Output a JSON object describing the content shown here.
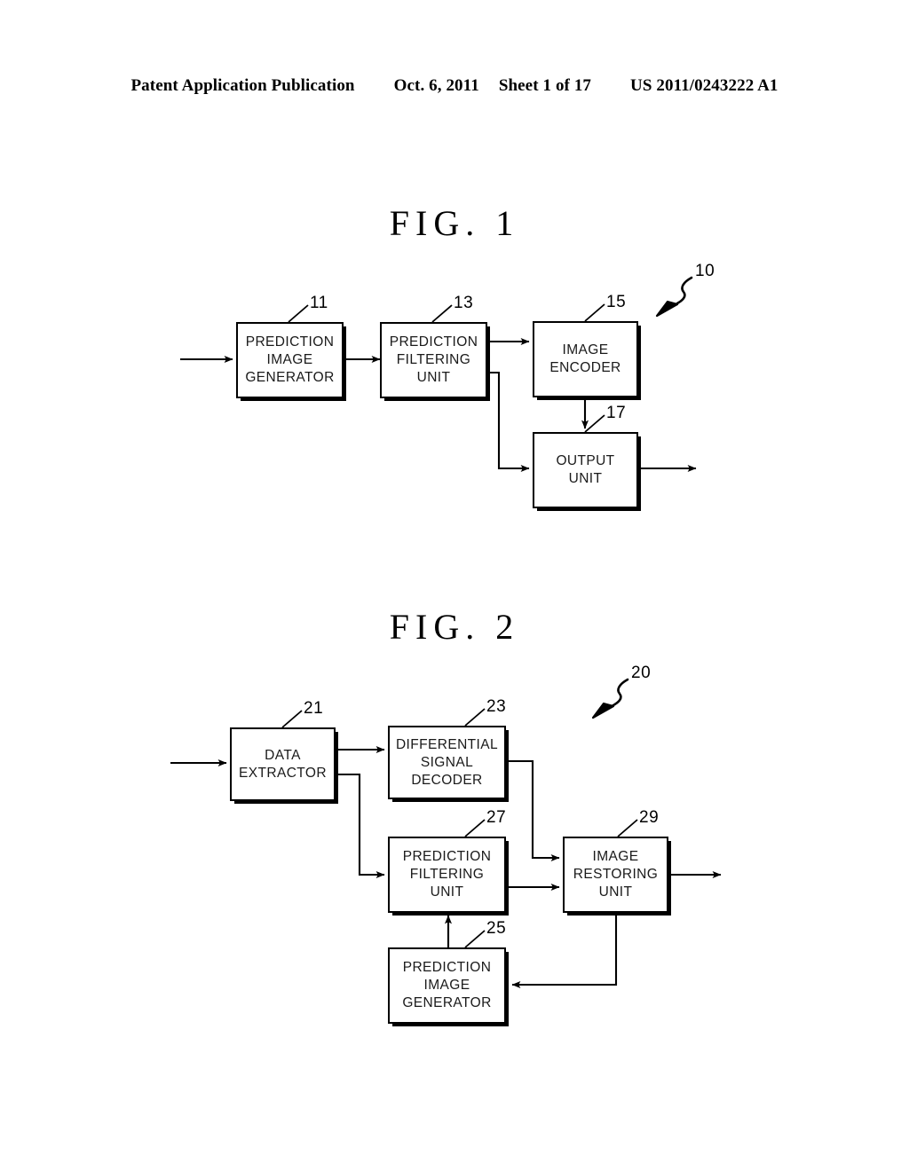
{
  "header": {
    "publication": "Patent Application Publication",
    "date": "Oct. 6, 2011",
    "sheet": "Sheet 1 of 17",
    "number": "US 2011/0243222 A1"
  },
  "figures": [
    {
      "id": "fig1",
      "title": "FIG.  1",
      "assembly_ref": "10",
      "blocks": [
        {
          "ref": "11",
          "lines": [
            "PREDICTION",
            "IMAGE",
            "GENERATOR"
          ]
        },
        {
          "ref": "13",
          "lines": [
            "PREDICTION",
            "FILTERING",
            "UNIT"
          ]
        },
        {
          "ref": "15",
          "lines": [
            "IMAGE",
            "ENCODER"
          ]
        },
        {
          "ref": "17",
          "lines": [
            "OUTPUT",
            "UNIT"
          ]
        }
      ]
    },
    {
      "id": "fig2",
      "title": "FIG.  2",
      "assembly_ref": "20",
      "blocks": [
        {
          "ref": "21",
          "lines": [
            "DATA",
            "EXTRACTOR"
          ]
        },
        {
          "ref": "23",
          "lines": [
            "DIFFERENTIAL",
            "SIGNAL",
            "DECODER"
          ]
        },
        {
          "ref": "27",
          "lines": [
            "PREDICTION",
            "FILTERING",
            "UNIT"
          ]
        },
        {
          "ref": "29",
          "lines": [
            "IMAGE",
            "RESTORING",
            "UNIT"
          ]
        },
        {
          "ref": "25",
          "lines": [
            "PREDICTION",
            "IMAGE",
            "GENERATOR"
          ]
        }
      ]
    }
  ],
  "colors": {
    "ink": "#000000",
    "paper": "#ffffff"
  }
}
